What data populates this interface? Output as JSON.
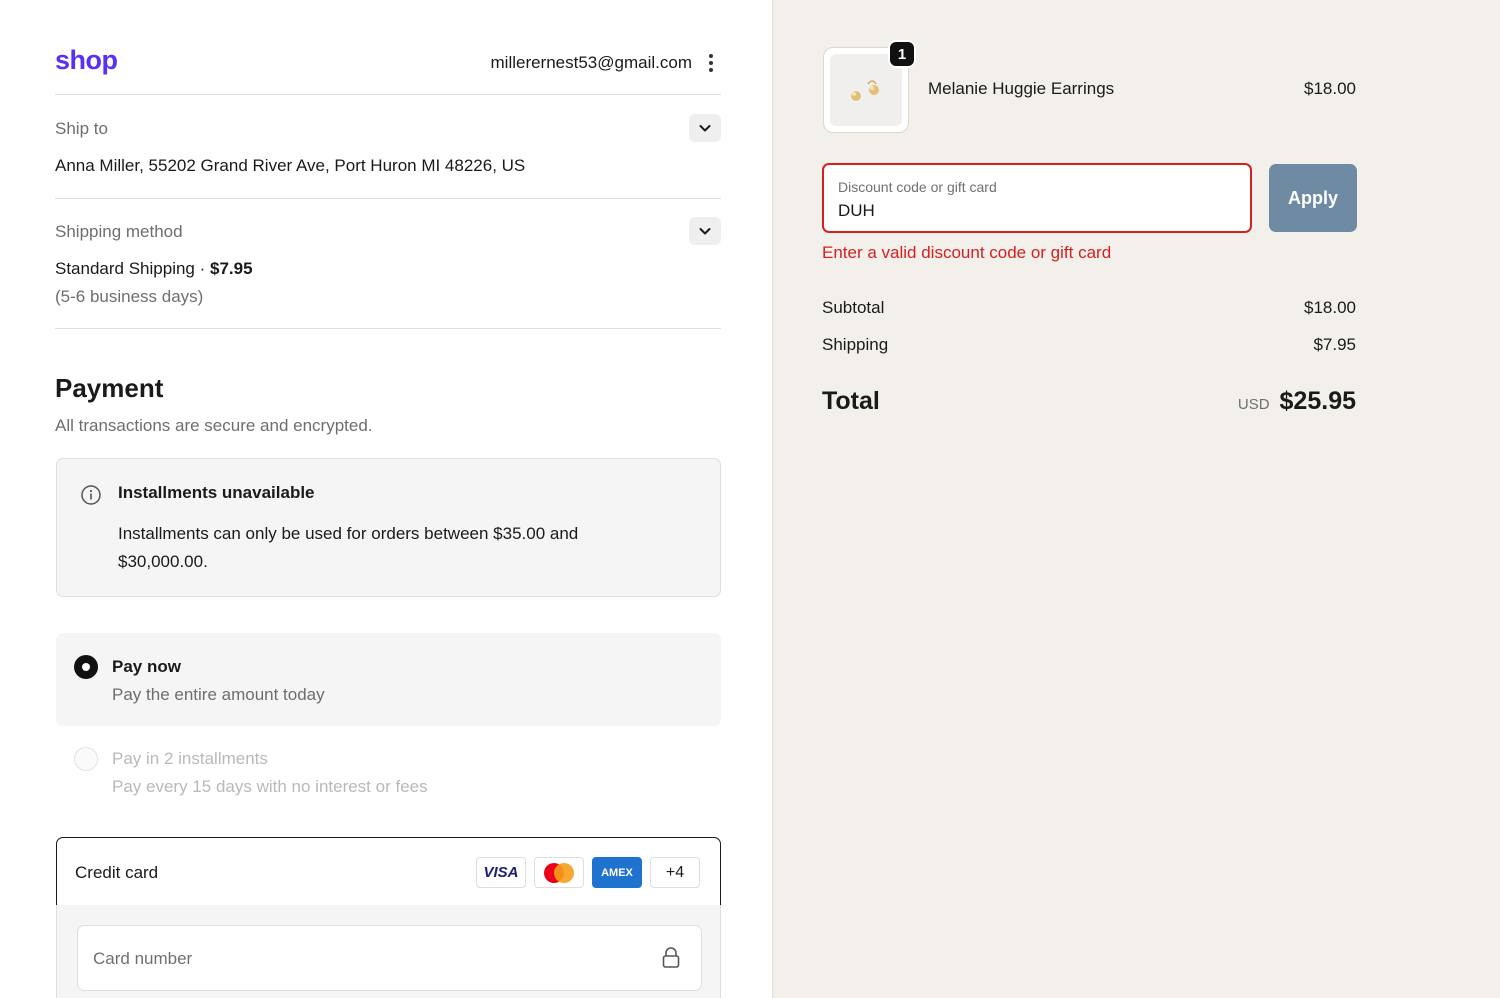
{
  "header": {
    "logo": "shop",
    "email": "millerernest53@gmail.com"
  },
  "ship_to": {
    "label": "Ship to",
    "address": "Anna Miller, 55202 Grand River Ave, Port Huron MI 48226, US"
  },
  "shipping_method": {
    "label": "Shipping method",
    "name": "Standard Shipping",
    "separator": " · ",
    "price": "$7.95",
    "eta": "(5-6 business days)"
  },
  "payment": {
    "title": "Payment",
    "subtitle": "All transactions are secure and encrypted.",
    "notice": {
      "title": "Installments unavailable",
      "body": "Installments can only be used for orders between $35.00 and $30,000.00."
    },
    "options": [
      {
        "title": "Pay now",
        "subtitle": "Pay the entire amount today",
        "selected": true,
        "disabled": false
      },
      {
        "title": "Pay in 2 installments",
        "subtitle": "Pay every 15 days with no interest or fees",
        "selected": false,
        "disabled": true
      }
    ],
    "credit_card": {
      "label": "Credit card",
      "brands": [
        "VISA",
        "mastercard",
        "AMEX"
      ],
      "more": "+4",
      "card_number_placeholder": "Card number"
    }
  },
  "order": {
    "item": {
      "name": "Melanie Huggie Earrings",
      "price": "$18.00",
      "quantity": "1"
    },
    "discount": {
      "label": "Discount code or gift card",
      "value": "DUH",
      "apply_label": "Apply",
      "error": "Enter a valid discount code or gift card"
    },
    "summary": {
      "subtotal_label": "Subtotal",
      "subtotal": "$18.00",
      "shipping_label": "Shipping",
      "shipping": "$7.95",
      "total_label": "Total",
      "currency": "USD",
      "total": "$25.95"
    }
  },
  "colors": {
    "brand": "#5a31f4",
    "error": "#d22121",
    "apply_button": "#6f8aa3",
    "summary_bg": "#f3f0eb"
  }
}
